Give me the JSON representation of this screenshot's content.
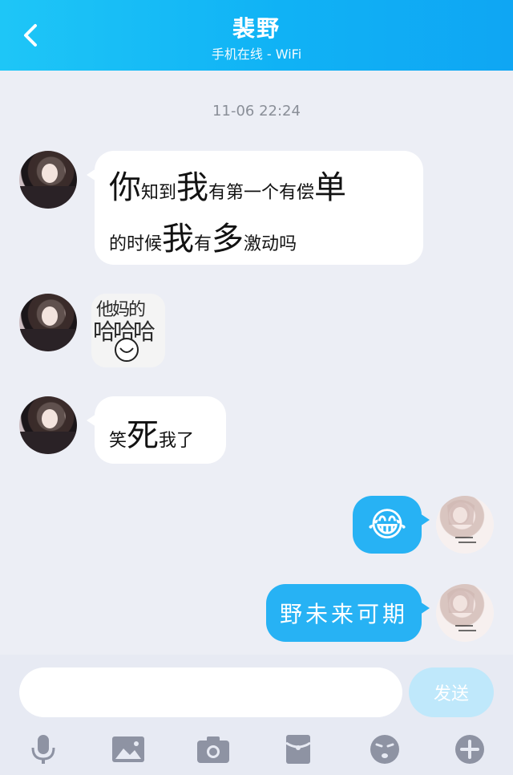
{
  "header": {
    "title": "裴野",
    "subtitle": "手机在线 - WiFi"
  },
  "chat": {
    "timestamp": "11-06 22:24",
    "messages": [
      {
        "side": "left",
        "type": "text",
        "line1": [
          {
            "t": "你",
            "s": "big"
          },
          {
            "t": "知到",
            "s": "sm"
          },
          {
            "t": "我",
            "s": "big"
          },
          {
            "t": "有",
            "s": "sm"
          },
          {
            "t": "第一个有偿",
            "s": "sm"
          },
          {
            "t": "单",
            "s": "big"
          }
        ],
        "line2": [
          {
            "t": "的",
            "s": "sm"
          },
          {
            "t": "时候",
            "s": "sm"
          },
          {
            "t": "我",
            "s": "big"
          },
          {
            "t": "有",
            "s": "sm"
          },
          {
            "t": "多",
            "s": "big"
          },
          {
            "t": "激动",
            "s": "sm"
          },
          {
            "t": "吗",
            "s": "sm"
          }
        ]
      },
      {
        "side": "left",
        "type": "sticker",
        "line1": "他妈的",
        "line2": "哈哈哈"
      },
      {
        "side": "left",
        "type": "text",
        "line1": [
          {
            "t": "笑",
            "s": "sm"
          },
          {
            "t": "死",
            "s": "big"
          },
          {
            "t": "我了",
            "s": "sm"
          }
        ]
      },
      {
        "side": "right",
        "type": "emoji",
        "emoji": "😂"
      },
      {
        "side": "right",
        "type": "text",
        "text": "野未来可期"
      }
    ]
  },
  "input": {
    "value": "",
    "placeholder": ""
  },
  "send_button": {
    "label": "发送"
  },
  "toolbar": {
    "icons": [
      "microphone-icon",
      "image-icon",
      "camera-icon",
      "red-packet-icon",
      "emoji-icon",
      "plus-icon"
    ]
  }
}
